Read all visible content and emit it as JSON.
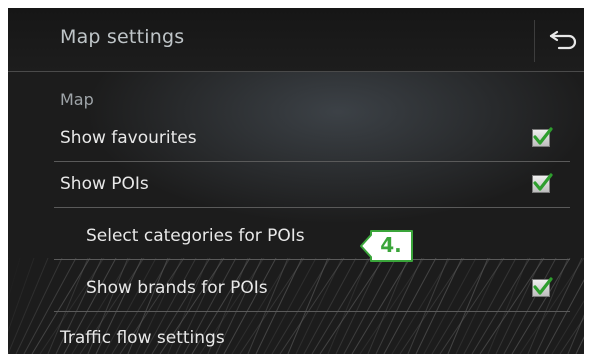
{
  "header": {
    "title": "Map settings",
    "back_icon": "back-arrow-icon"
  },
  "section": {
    "label": "Map"
  },
  "items": [
    {
      "label": "Show favourites",
      "checked": true
    },
    {
      "label": "Show POIs",
      "checked": true
    },
    {
      "label": "Select categories for POIs"
    },
    {
      "label": "Show brands for POIs",
      "checked": true
    },
    {
      "label": "Traffic flow settings"
    }
  ],
  "callout": {
    "label": "4."
  },
  "colors": {
    "accent_green": "#3aa53a",
    "background": "#1c1c1c",
    "text": "#e8e8e8"
  }
}
